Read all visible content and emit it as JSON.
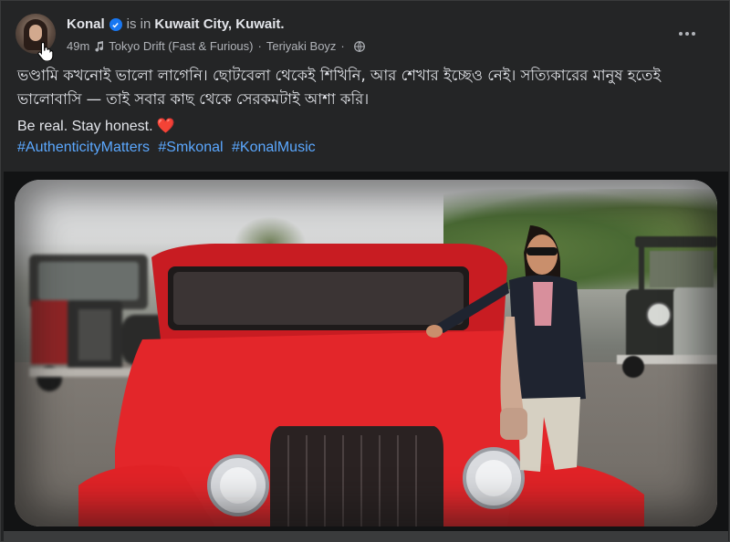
{
  "post": {
    "author": "Konal",
    "checkin_prefix": "is in",
    "location": "Kuwait City, Kuwait.",
    "timestamp": "49m",
    "music_track": "Tokyo Drift (Fast & Furious)",
    "music_artist": "Teriyaki Boyz",
    "separator": "·",
    "body_bengali": "ভণ্ডামি কখনোই ভালো লাগেনি। ছোটবেলা থেকেই শিখিনি, আর শেখার ইচ্ছেও নেই। সত্যিকারের মানুষ হতেই ভালোবাসি — তাই সবার কাছ থেকে সেরকমটাই আশা করি।",
    "body_english": "Be real. Stay honest.",
    "heart": "❤️",
    "hashtags": [
      "#AuthenticityMatters",
      "#Smkonal",
      "#KonalMusic"
    ]
  },
  "icons": {
    "verified": "verified-badge-icon",
    "music": "music-note-icon",
    "privacy": "globe-icon",
    "more": "more-options-icon",
    "cursor": "hand-cursor-icon"
  },
  "colors": {
    "card_bg": "#242526",
    "text": "#e4e6eb",
    "secondary_text": "#b0b3b8",
    "link": "#5ba8ff",
    "verified": "#1877f2",
    "heart": "#e41e3f",
    "car_red": "#e3262a"
  }
}
